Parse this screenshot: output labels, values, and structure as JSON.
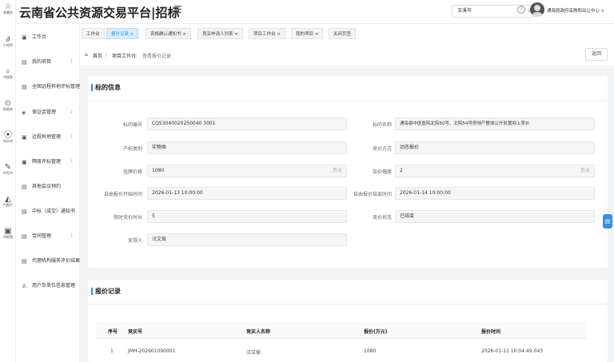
{
  "rail": [
    {
      "icon": "☆",
      "label": "收藏夹"
    },
    {
      "icon": "∂",
      "label": "小程序"
    },
    {
      "icon": "⌕",
      "label": "AI搜索"
    },
    {
      "icon": "⊙",
      "label": "智能体"
    },
    {
      "icon": "⦿",
      "label": "知识库"
    },
    {
      "icon": "✎",
      "label": "AI写作"
    },
    {
      "icon": "◭",
      "label": "AI图片"
    },
    {
      "icon": "▣",
      "label": "AI视频"
    }
  ],
  "header": {
    "title": "云南省公共资源交易平台|招标",
    "menu_icon": "☰",
    "region": "玉溪市",
    "region_arrow": "∨",
    "help": "?",
    "user": "通海县政府采购和出让中心 ∨"
  },
  "sidemenu": [
    {
      "icon": "▣",
      "label": "工作台",
      "chev": ""
    },
    {
      "icon": "▤",
      "label": "我的项目",
      "chev": "〉"
    },
    {
      "icon": "▤",
      "label": "全国远程异地评标管理",
      "chev": ""
    },
    {
      "icon": "◈",
      "label": "保证金管理",
      "chev": "〉"
    },
    {
      "icon": "▣",
      "label": "远程异地管理",
      "chev": "〉"
    },
    {
      "icon": "▣",
      "label": "隔夜评标管理",
      "chev": "〉"
    },
    {
      "icon": "▤",
      "label": "其他会议预约",
      "chev": ""
    },
    {
      "icon": "▤",
      "label": "中标（成交）通知书",
      "chev": ""
    },
    {
      "icon": "▤",
      "label": "合同管理",
      "chev": "〉"
    },
    {
      "icon": "▤",
      "label": "代理机构服务评价结果",
      "chev": ""
    },
    {
      "icon": "♙",
      "label": "用户及单位信息管理",
      "chev": ""
    }
  ],
  "tabs": [
    {
      "label": "工作台"
    },
    {
      "label": "报价记录 ×"
    },
    {
      "label": "资格确认通知书 ×"
    },
    {
      "label": "竞买申请人列表 ×"
    },
    {
      "label": "项目工作台 ×"
    },
    {
      "label": "我的项目 ×"
    },
    {
      "label": "关闭页签"
    }
  ],
  "breadcrumb": {
    "home": "首页",
    "sep": "〉",
    "level2": "项目工作台",
    "current": "查看报价记录",
    "back": "返回"
  },
  "info": {
    "title": "标的信息",
    "fields": {
      "biaodi_no_label": "标的编号",
      "biaodi_no": "CQ53040020250040 3001",
      "biaodi_name_label": "标的名称",
      "biaodi_name": "通海县中医医院北院50号、北院54号房地产整体公开处置网上竞价",
      "rights_label": "产权类别",
      "rights": "实物类",
      "bid_method_label": "竞价方式",
      "bid_method": "动态报价",
      "price_label": "挂牌价格",
      "price": "1080",
      "price_unit": "万元",
      "step_label": "加价幅度",
      "step": "2",
      "step_unit": "万元",
      "start_label": "自由报价开始时间",
      "start": "2026-01-13 10:00:00",
      "end_label": "自由报价结束时间",
      "end": "2026-01-14 10:00:00",
      "limit_label": "限时竞价时长",
      "limit": "5",
      "status_label": "竞价状态",
      "status": "已结束",
      "winner_label": "竞得人",
      "winner": "汪文俊"
    }
  },
  "records": {
    "title": "报价记录",
    "headers": [
      "序号",
      "竞买号",
      "竞买人名称",
      "报价(万元)",
      "报价时间"
    ],
    "rows": [
      [
        "1",
        "JMH-202601090001",
        "汪文俊",
        "1080",
        "2026-01-13 10:04:49.043"
      ]
    ]
  },
  "float_icon": "▤"
}
